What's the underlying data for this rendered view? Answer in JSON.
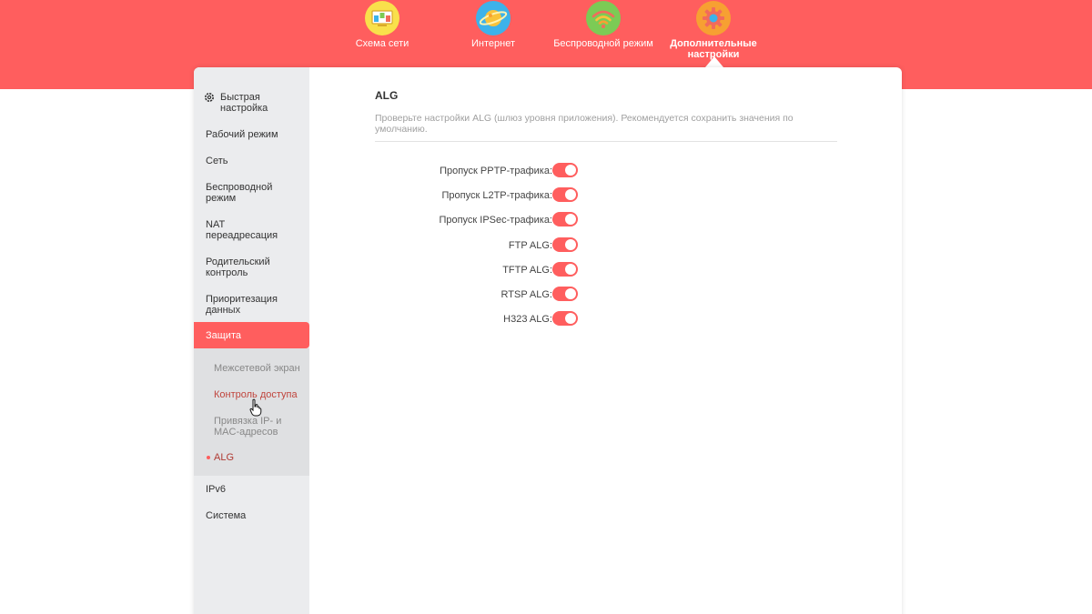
{
  "top_nav": {
    "items": [
      {
        "label": "Схема сети",
        "icon": "network-map-icon",
        "color": "#f9e04b"
      },
      {
        "label": "Интернет",
        "icon": "globe-planet-icon",
        "color": "#3db2ea"
      },
      {
        "label": "Беспроводной режим",
        "icon": "wifi-icon",
        "color": "#7ccb55"
      },
      {
        "label": "Дополнительные настройки",
        "icon": "gear-icon",
        "color": "#f7a032",
        "active": true
      }
    ]
  },
  "sidebar": {
    "quick_setup": "Быстрая настройка",
    "items": [
      "Рабочий режим",
      "Сеть",
      "Беспроводной режим",
      "NAT переадресация",
      "Родительский контроль",
      "Приоритезация данных"
    ],
    "active": "Защита",
    "sub_items": [
      "Межсетевой экран",
      "Контроль доступа",
      "Привязка IP- и MAC-адресов",
      "ALG"
    ],
    "after_items": [
      "IPv6",
      "Система"
    ]
  },
  "main": {
    "title": "ALG",
    "description": "Проверьте настройки ALG (шлюз уровня приложения). Рекомендуется сохранить значения по умолчанию.",
    "toggles": [
      {
        "label": "Пропуск PPTP-трафика:",
        "on": true
      },
      {
        "label": "Пропуск L2TP-трафика:",
        "on": true
      },
      {
        "label": "Пропуск IPSec-трафика:",
        "on": true
      },
      {
        "label": "FTP ALG:",
        "on": true
      },
      {
        "label": "TFTP ALG:",
        "on": true
      },
      {
        "label": "RTSP ALG:",
        "on": true
      },
      {
        "label": "H323 ALG:",
        "on": true
      }
    ]
  },
  "colors": {
    "accent": "#ff5e5e",
    "sidebar_bg": "#ebecee",
    "submenu_bg": "#dfe0e2"
  }
}
